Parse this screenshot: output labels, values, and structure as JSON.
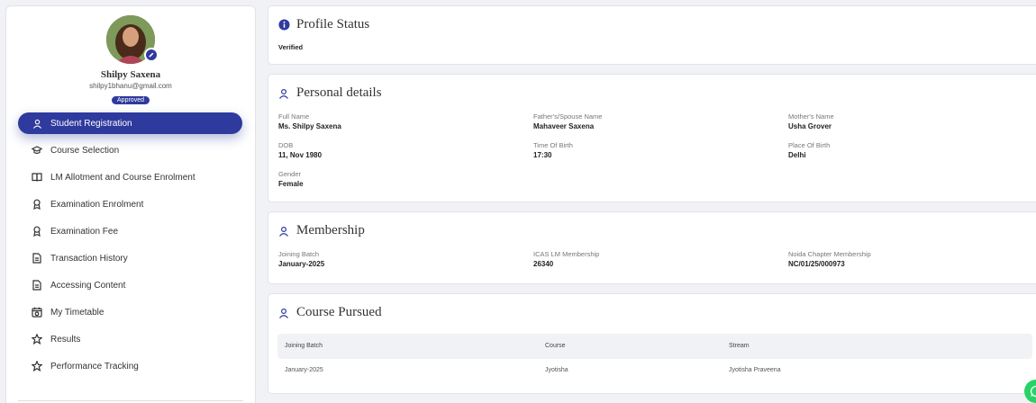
{
  "profile": {
    "name": "Shilpy Saxena",
    "email": "shilpy1bhanu@gmail.com",
    "status": "Approved"
  },
  "nav": {
    "items": [
      {
        "label": "Student Registration",
        "icon": "person-icon",
        "active": true
      },
      {
        "label": "Course Selection",
        "icon": "graduation-cap-icon"
      },
      {
        "label": "LM Allotment and Course Enrolment",
        "icon": "open-book-icon"
      },
      {
        "label": "Examination Enrolment",
        "icon": "award-icon"
      },
      {
        "label": "Examination Fee",
        "icon": "award-icon"
      },
      {
        "label": "Transaction History",
        "icon": "document-icon"
      },
      {
        "label": "Accessing Content",
        "icon": "document-icon"
      },
      {
        "label": "My Timetable",
        "icon": "calendar-icon"
      },
      {
        "label": "Results",
        "icon": "star-icon"
      },
      {
        "label": "Performance Tracking",
        "icon": "star-icon"
      }
    ]
  },
  "profile_status": {
    "title": "Profile Status",
    "value": "Verified"
  },
  "personal": {
    "title": "Personal details",
    "full_name_label": "Full Name",
    "full_name": "Ms. Shilpy Saxena",
    "father_label": "Father's/Spouse Name",
    "father": "Mahaveer Saxena",
    "mother_label": "Mother's Name",
    "mother": "Usha Grover",
    "dob_label": "DOB",
    "dob": "11, Nov 1980",
    "tob_label": "Time Of Birth",
    "tob": "17:30",
    "pob_label": "Place Of Birth",
    "pob": "Delhi",
    "gender_label": "Gender",
    "gender": "Female"
  },
  "membership": {
    "title": "Membership",
    "batch_label": "Joining Batch",
    "batch": "January-2025",
    "icas_label": "ICAS LM Membership",
    "icas": "26340",
    "noida_label": "Noida Chapter Membership",
    "noida": "NC/01/25/000973"
  },
  "course": {
    "title": "Course Pursued",
    "columns": [
      "Joining Batch",
      "Course",
      "Stream"
    ],
    "rows": [
      [
        "January-2025",
        "Jyotisha",
        "Jyotisha Praveena"
      ]
    ]
  },
  "colors": {
    "primary": "#2f3a9e",
    "whatsapp": "#25d366"
  }
}
